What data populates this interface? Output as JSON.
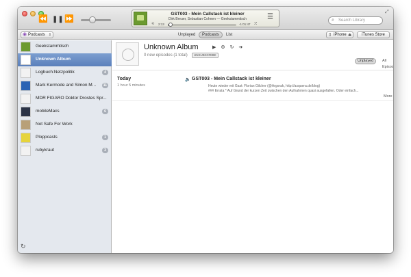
{
  "player": {
    "now_playing_title": "GST003 - Mein Callstack ist kleiner",
    "now_playing_artist": "Dirk Breuer, Sebastian Cohnen — Geekstammtisch",
    "elapsed": "2:13",
    "remaining": "-1:01:47",
    "progress_fraction": 0.035,
    "volume_fraction": 0.45,
    "search_placeholder": "Search Library"
  },
  "navbar": {
    "media_select_label": "Podcasts",
    "tabs": [
      {
        "label": "Unplayed",
        "active": false
      },
      {
        "label": "Podcasts",
        "active": true
      },
      {
        "label": "List",
        "active": false
      }
    ],
    "device_label": "iPhone",
    "store_label": "iTunes Store"
  },
  "sidebar": {
    "items": [
      {
        "label": "Geekstammtisch",
        "badge": "",
        "selected": false,
        "thumb_color": "#6b9a2f"
      },
      {
        "label": "Unknown Album",
        "badge": "",
        "selected": true,
        "thumb_color": "#ffffff"
      },
      {
        "label": "Logbuch:Netzpolitik",
        "badge": "4",
        "selected": false,
        "thumb_color": "#f2f2f2"
      },
      {
        "label": "Mark Kermode and Simon M...",
        "badge": "11",
        "selected": false,
        "thumb_color": "#2a63b4"
      },
      {
        "label": "MDR FIGARO Doktor Drostes Spr...",
        "badge": "",
        "selected": false,
        "thumb_color": "#f2f2f2"
      },
      {
        "label": "mobileMacs",
        "badge": "6",
        "selected": false,
        "thumb_color": "#2b3346"
      },
      {
        "label": "Not Safe For Work",
        "badge": "",
        "selected": false,
        "thumb_color": "#b8a078"
      },
      {
        "label": "Ploppcasts",
        "badge": "1",
        "selected": false,
        "thumb_color": "#e6d43c"
      },
      {
        "label": "rubykraut",
        "badge": "3",
        "selected": false,
        "thumb_color": "#f2f2f2"
      }
    ]
  },
  "album": {
    "title": "Unknown Album",
    "subtitle": "0 new episodes (1 total)",
    "unsubscribe_label": "UNSUBSCRIBE",
    "filters": [
      {
        "label": "Unplayed",
        "active": true
      },
      {
        "label": "All Episodes",
        "active": false
      }
    ]
  },
  "episodes": {
    "group_title": "Today",
    "group_duration": "1 hour 5 minutes",
    "title": "GST003 - Mein Callstack ist kleiner",
    "description_line1": "Heute wieder mit Gast: Florian Gilcher (@Argorak, http://asquera.de/blog)",
    "description_line2": "### Errata  * Auf Grund der kurzen Zeit zwischen den Aufnahmen quasi ausgefallen. Oder einfach...",
    "more_label": "More"
  },
  "icons": {
    "rewind": "⏪",
    "pause": "❚❚",
    "forward": "⏩",
    "up_next": "☰",
    "search": "⌕",
    "fullscreen": "⤢",
    "podcast": "◉",
    "phone": "▯",
    "eject": "⏏",
    "refresh": "↻",
    "speaker": "🔈",
    "play": "▶",
    "gear": "⚙",
    "reload": "↻",
    "info": "➜",
    "loop": "⟲",
    "shuffle": "⤮"
  }
}
